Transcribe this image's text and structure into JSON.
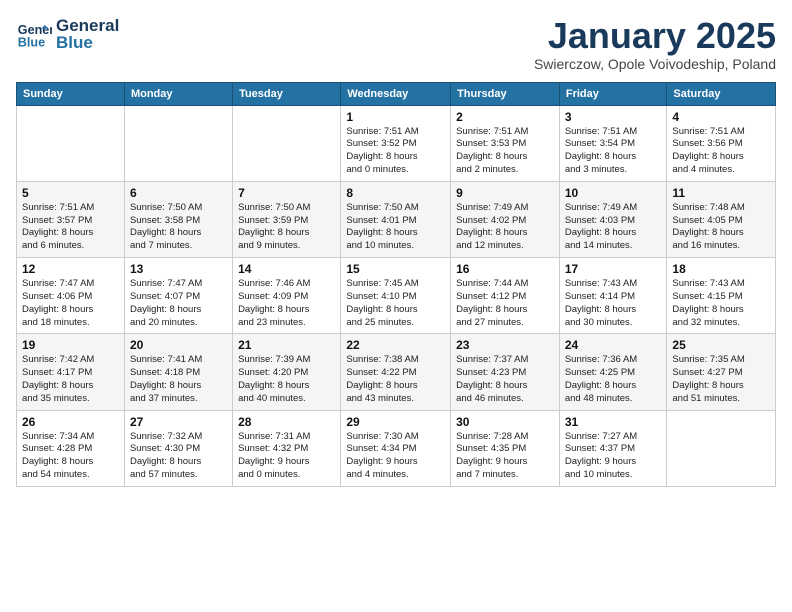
{
  "header": {
    "logo_general": "General",
    "logo_blue": "Blue",
    "month_title": "January 2025",
    "subtitle": "Swierczow, Opole Voivodeship, Poland"
  },
  "weekdays": [
    "Sunday",
    "Monday",
    "Tuesday",
    "Wednesday",
    "Thursday",
    "Friday",
    "Saturday"
  ],
  "weeks": [
    [
      {
        "day": "",
        "content": ""
      },
      {
        "day": "",
        "content": ""
      },
      {
        "day": "",
        "content": ""
      },
      {
        "day": "1",
        "content": "Sunrise: 7:51 AM\nSunset: 3:52 PM\nDaylight: 8 hours\nand 0 minutes."
      },
      {
        "day": "2",
        "content": "Sunrise: 7:51 AM\nSunset: 3:53 PM\nDaylight: 8 hours\nand 2 minutes."
      },
      {
        "day": "3",
        "content": "Sunrise: 7:51 AM\nSunset: 3:54 PM\nDaylight: 8 hours\nand 3 minutes."
      },
      {
        "day": "4",
        "content": "Sunrise: 7:51 AM\nSunset: 3:56 PM\nDaylight: 8 hours\nand 4 minutes."
      }
    ],
    [
      {
        "day": "5",
        "content": "Sunrise: 7:51 AM\nSunset: 3:57 PM\nDaylight: 8 hours\nand 6 minutes."
      },
      {
        "day": "6",
        "content": "Sunrise: 7:50 AM\nSunset: 3:58 PM\nDaylight: 8 hours\nand 7 minutes."
      },
      {
        "day": "7",
        "content": "Sunrise: 7:50 AM\nSunset: 3:59 PM\nDaylight: 8 hours\nand 9 minutes."
      },
      {
        "day": "8",
        "content": "Sunrise: 7:50 AM\nSunset: 4:01 PM\nDaylight: 8 hours\nand 10 minutes."
      },
      {
        "day": "9",
        "content": "Sunrise: 7:49 AM\nSunset: 4:02 PM\nDaylight: 8 hours\nand 12 minutes."
      },
      {
        "day": "10",
        "content": "Sunrise: 7:49 AM\nSunset: 4:03 PM\nDaylight: 8 hours\nand 14 minutes."
      },
      {
        "day": "11",
        "content": "Sunrise: 7:48 AM\nSunset: 4:05 PM\nDaylight: 8 hours\nand 16 minutes."
      }
    ],
    [
      {
        "day": "12",
        "content": "Sunrise: 7:47 AM\nSunset: 4:06 PM\nDaylight: 8 hours\nand 18 minutes."
      },
      {
        "day": "13",
        "content": "Sunrise: 7:47 AM\nSunset: 4:07 PM\nDaylight: 8 hours\nand 20 minutes."
      },
      {
        "day": "14",
        "content": "Sunrise: 7:46 AM\nSunset: 4:09 PM\nDaylight: 8 hours\nand 23 minutes."
      },
      {
        "day": "15",
        "content": "Sunrise: 7:45 AM\nSunset: 4:10 PM\nDaylight: 8 hours\nand 25 minutes."
      },
      {
        "day": "16",
        "content": "Sunrise: 7:44 AM\nSunset: 4:12 PM\nDaylight: 8 hours\nand 27 minutes."
      },
      {
        "day": "17",
        "content": "Sunrise: 7:43 AM\nSunset: 4:14 PM\nDaylight: 8 hours\nand 30 minutes."
      },
      {
        "day": "18",
        "content": "Sunrise: 7:43 AM\nSunset: 4:15 PM\nDaylight: 8 hours\nand 32 minutes."
      }
    ],
    [
      {
        "day": "19",
        "content": "Sunrise: 7:42 AM\nSunset: 4:17 PM\nDaylight: 8 hours\nand 35 minutes."
      },
      {
        "day": "20",
        "content": "Sunrise: 7:41 AM\nSunset: 4:18 PM\nDaylight: 8 hours\nand 37 minutes."
      },
      {
        "day": "21",
        "content": "Sunrise: 7:39 AM\nSunset: 4:20 PM\nDaylight: 8 hours\nand 40 minutes."
      },
      {
        "day": "22",
        "content": "Sunrise: 7:38 AM\nSunset: 4:22 PM\nDaylight: 8 hours\nand 43 minutes."
      },
      {
        "day": "23",
        "content": "Sunrise: 7:37 AM\nSunset: 4:23 PM\nDaylight: 8 hours\nand 46 minutes."
      },
      {
        "day": "24",
        "content": "Sunrise: 7:36 AM\nSunset: 4:25 PM\nDaylight: 8 hours\nand 48 minutes."
      },
      {
        "day": "25",
        "content": "Sunrise: 7:35 AM\nSunset: 4:27 PM\nDaylight: 8 hours\nand 51 minutes."
      }
    ],
    [
      {
        "day": "26",
        "content": "Sunrise: 7:34 AM\nSunset: 4:28 PM\nDaylight: 8 hours\nand 54 minutes."
      },
      {
        "day": "27",
        "content": "Sunrise: 7:32 AM\nSunset: 4:30 PM\nDaylight: 8 hours\nand 57 minutes."
      },
      {
        "day": "28",
        "content": "Sunrise: 7:31 AM\nSunset: 4:32 PM\nDaylight: 9 hours\nand 0 minutes."
      },
      {
        "day": "29",
        "content": "Sunrise: 7:30 AM\nSunset: 4:34 PM\nDaylight: 9 hours\nand 4 minutes."
      },
      {
        "day": "30",
        "content": "Sunrise: 7:28 AM\nSunset: 4:35 PM\nDaylight: 9 hours\nand 7 minutes."
      },
      {
        "day": "31",
        "content": "Sunrise: 7:27 AM\nSunset: 4:37 PM\nDaylight: 9 hours\nand 10 minutes."
      },
      {
        "day": "",
        "content": ""
      }
    ]
  ]
}
